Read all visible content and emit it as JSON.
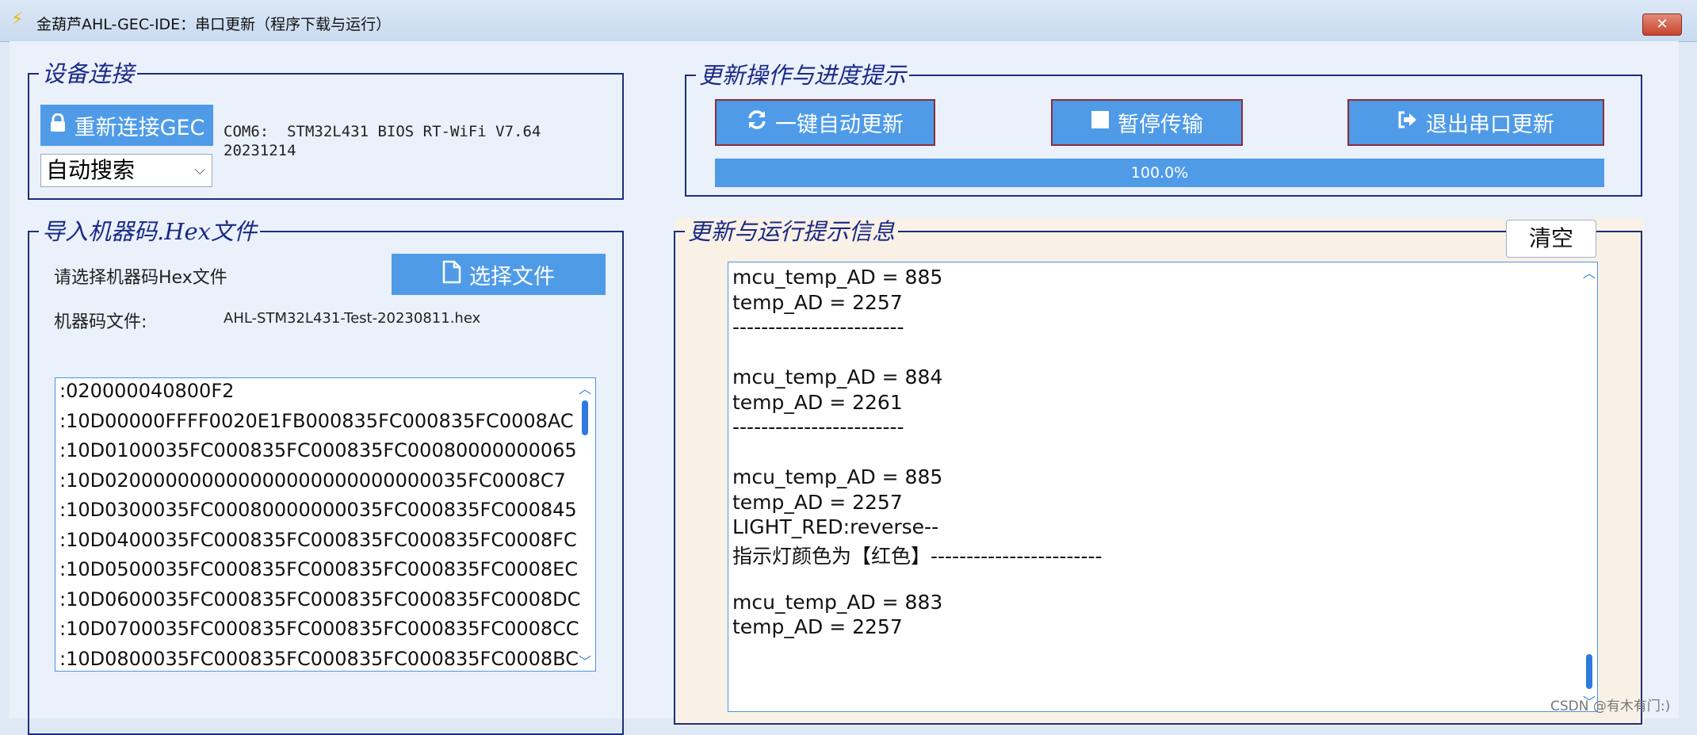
{
  "window": {
    "title": "金葫芦AHL-GEC-IDE：串口更新（程序下载与运行）",
    "close_glyph": "✕"
  },
  "device": {
    "legend": "设备连接",
    "reconnect_label": "重新连接GEC",
    "search_mode": "自动搜索",
    "status_line1": "COM6:  STM32L431 BIOS RT-WiFi V7.64",
    "status_line2": "20231214"
  },
  "import": {
    "legend": "导入机器码.Hex文件",
    "prompt": "请选择机器码Hex文件",
    "choose_label": "选择文件",
    "file_label": "机器码文件:",
    "file_name": "AHL-STM32L431-Test-20230811.hex",
    "hex_lines": [
      ":020000040800F2",
      ":10D00000FFFF0020E1FB000835FC000835FC0008AC",
      ":10D0100035FC000835FC000835FC00080000000065",
      ":10D020000000000000000000000000035FC0008C7",
      ":10D0300035FC00080000000035FC000835FC000845",
      ":10D0400035FC000835FC000835FC000835FC0008FC",
      ":10D0500035FC000835FC000835FC000835FC0008EC",
      ":10D0600035FC000835FC000835FC000835FC0008DC",
      ":10D0700035FC000835FC000835FC000835FC0008CC",
      ":10D0800035FC000835FC000835FC000835FC0008BC"
    ]
  },
  "update": {
    "legend": "更新操作与进度提示",
    "auto_update_label": "一键自动更新",
    "pause_label": "暂停传输",
    "exit_label": "退出串口更新",
    "progress_text": "100.0%",
    "progress_value": 1.0
  },
  "log": {
    "legend": "更新与运行提示信息",
    "clear_label": "清空",
    "lines": [
      "mcu_temp_AD = 885",
      "temp_AD = 2257",
      "------------------------",
      "",
      "mcu_temp_AD = 884",
      "temp_AD = 2261",
      "------------------------",
      "",
      "mcu_temp_AD = 885",
      "temp_AD = 2257",
      " LIGHT_RED:reverse--",
      "指示灯颜色为【红色】------------------------",
      "",
      "mcu_temp_AD = 883",
      "temp_AD = 2257"
    ]
  },
  "watermark": "CSDN @有木有门:)",
  "colors": {
    "accent": "#4f9be8",
    "group_border": "#1b2e7c",
    "legend_text": "#1a2a86",
    "button_border": "#8b2e3a",
    "log_background": "#f9f1e6"
  },
  "icons": {
    "title": "lightning-icon",
    "reconnect": "lock-icon",
    "choose_file": "document-icon",
    "auto_update": "refresh-icon",
    "pause": "stop-icon",
    "exit": "sign-out-icon"
  }
}
